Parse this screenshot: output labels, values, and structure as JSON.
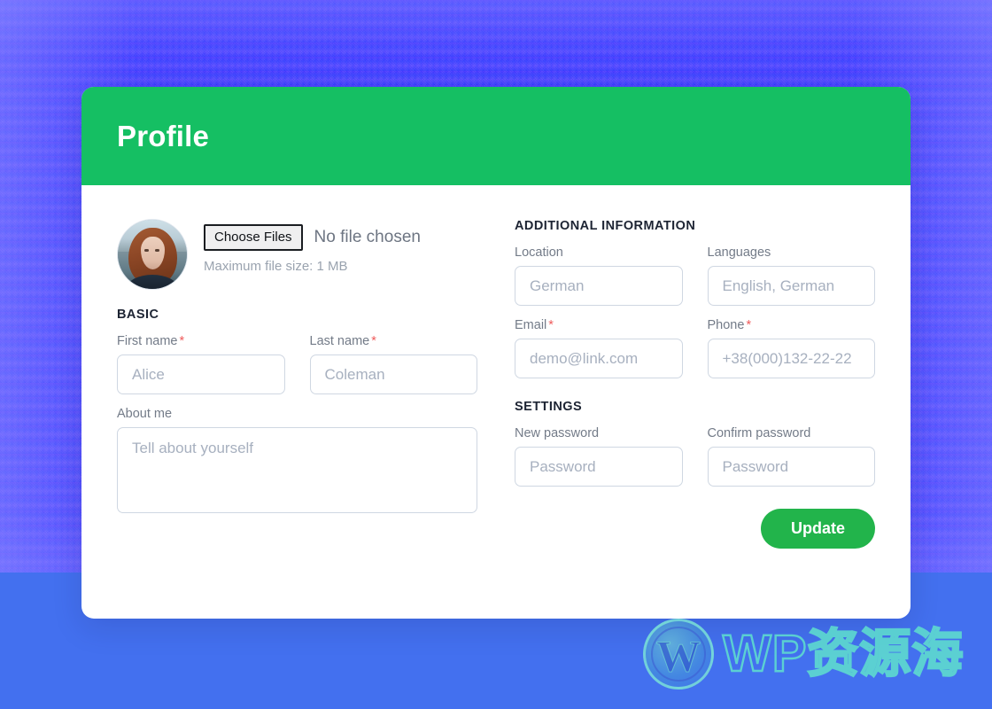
{
  "page": {
    "background_color_top": "#4a45ef",
    "background_color_bottom": "#4370ef"
  },
  "card": {
    "header": {
      "title": "Profile",
      "background_color": "#15bf63",
      "title_color": "#ffffff"
    },
    "upload": {
      "avatar_alt": "user-avatar-photo",
      "choose_files_label": "Choose Files",
      "no_file_text": "No file chosen",
      "max_size_text": "Maximum file size: 1 MB"
    },
    "left_column": {
      "section_title": "BASIC",
      "fields": [
        {
          "label": "First name",
          "required": true,
          "placeholder": "Alice",
          "value": "",
          "type": "text",
          "name": "first-name"
        },
        {
          "label": "Last name",
          "required": true,
          "placeholder": "Coleman",
          "value": "",
          "type": "text",
          "name": "last-name"
        },
        {
          "label": "About me",
          "required": false,
          "placeholder": "Tell about yourself",
          "value": "",
          "type": "textarea",
          "name": "about-me"
        }
      ]
    },
    "right_column": {
      "section_title": "ADDITIONAL INFORMATION",
      "fields": [
        {
          "label": "Location",
          "required": false,
          "placeholder": "German",
          "value": "",
          "type": "text",
          "name": "location"
        },
        {
          "label": "Languages",
          "required": false,
          "placeholder": "English, German",
          "value": "",
          "type": "text",
          "name": "languages"
        },
        {
          "label": "Email",
          "required": true,
          "placeholder": "demo@link.com",
          "value": "",
          "type": "email",
          "name": "email"
        },
        {
          "label": "Phone",
          "required": true,
          "placeholder": "+38(000)132-22-22",
          "value": "",
          "type": "tel",
          "name": "phone"
        }
      ],
      "settings_title": "SETTINGS",
      "settings_fields": [
        {
          "label": "New password",
          "required": false,
          "placeholder": "Password",
          "value": "",
          "type": "password",
          "name": "new-password"
        },
        {
          "label": "Confirm password",
          "required": false,
          "placeholder": "Password",
          "value": "",
          "type": "password",
          "name": "confirm-password"
        }
      ],
      "submit": {
        "label": "Update",
        "background_color": "#22b44b",
        "text_color": "#ffffff"
      }
    },
    "required_marker": "*",
    "required_marker_color": "#ef5b5b"
  },
  "watermark": {
    "logo_letter": "W",
    "text": "WP资源海",
    "color": "#5fe1cd"
  }
}
